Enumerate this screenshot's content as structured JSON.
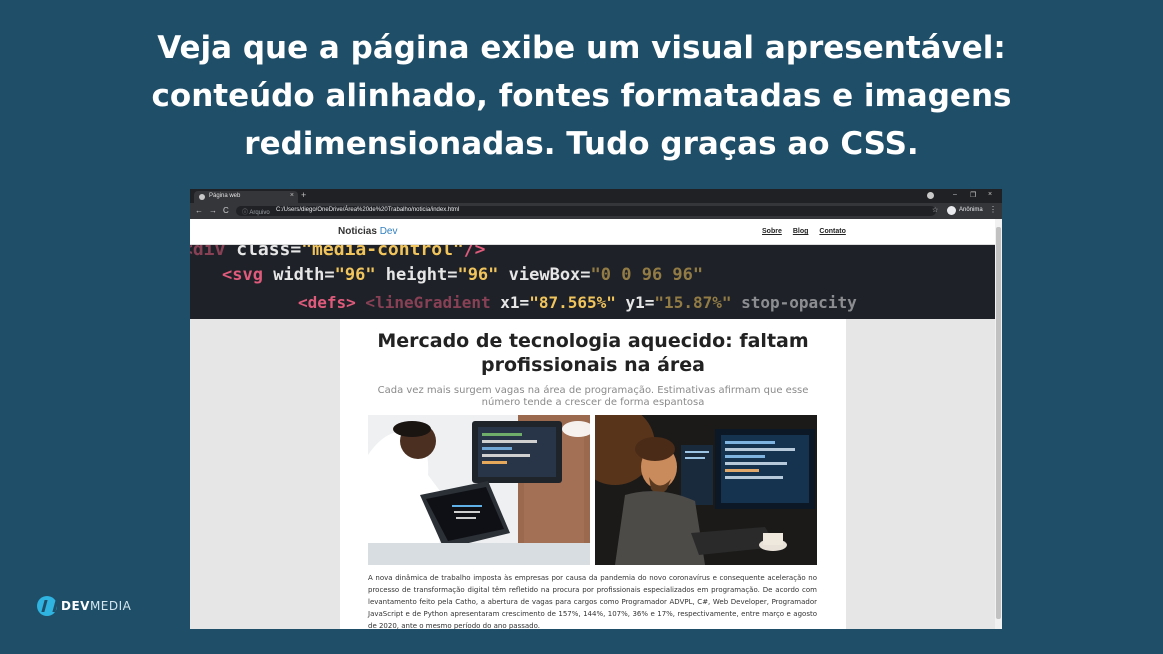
{
  "slide": {
    "title_lines": [
      "Veja que a página exibe um visual apresentável:",
      "conteúdo alinhado, fontes formatadas e imagens",
      "redimensionadas. Tudo graças ao CSS."
    ]
  },
  "browser": {
    "tab_title": "Página web",
    "tab_close": "×",
    "new_tab": "+",
    "window_controls": {
      "minimize": "–",
      "restore": "❐",
      "close": "×"
    },
    "url_scheme": "ⓘ Arquivo",
    "url": "C:/Users/diego/OneDrive/Área%20de%20Trabalho/noticia/index.html",
    "account_name": "Anônima",
    "back_icon": "←",
    "forward_icon": "→",
    "reload_icon": "C",
    "star_icon": "☆",
    "menu_icon": "⋮"
  },
  "site": {
    "logo_main": "Noticias",
    "logo_accent": "Dev",
    "nav": [
      "Sobre",
      "Blog",
      "Contato"
    ],
    "hero_code": {
      "line1": [
        "<div",
        " class=",
        "\"media-control\"",
        "/>"
      ],
      "line2": [
        "<svg",
        " width=",
        "\"96\"",
        " height=",
        "\"96\"",
        " viewBox=",
        "\"0 0 96 96\""
      ],
      "line3": [
        "<defs>",
        "  <lineGradient",
        " x1=",
        "\"87.565%\"",
        " y1=",
        "\"15.87%\"",
        " stop-opacity"
      ]
    }
  },
  "article": {
    "headline_lines": [
      "Mercado de tecnologia aquecido: faltam",
      "profissionais na área"
    ],
    "subhead_lines": [
      "Cada vez mais surgem vagas na área de programação. Estimativas afirmam que esse",
      "número tende a crescer de forma espantosa"
    ],
    "body": "A nova dinâmica de trabalho imposta às empresas por causa da pandemia do novo coronavírus e consequente aceleração no processo de transformação digital têm refletido na procura por profissionais especializados em programação. De acordo com levantamento feito pela Catho, a abertura de vagas para cargos como Programador ADVPL, C#, Web Developer, Programador JavaScript e de Python apresentaram crescimento de 157%, 144%, 107%, 36% e 17%, respectivamente, entre março e agosto de 2020, ante o mesmo período do ano passado."
  },
  "brand": {
    "name_bold": "DEV",
    "name_light": "MEDIA"
  }
}
